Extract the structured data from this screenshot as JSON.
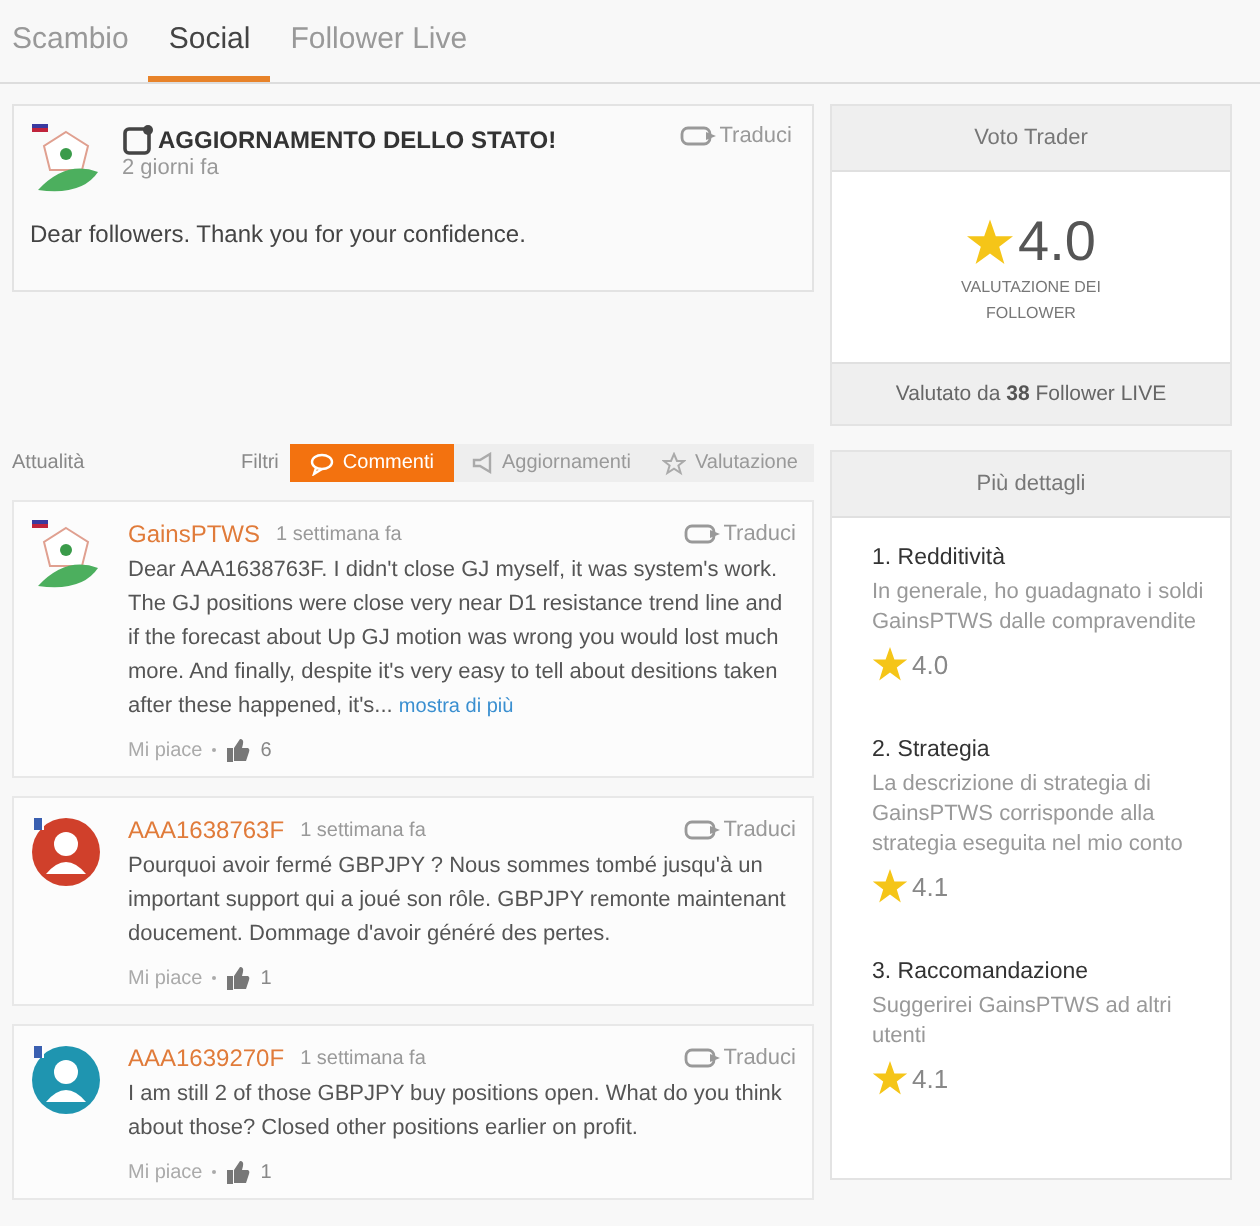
{
  "tabs": [
    {
      "label": "Scambio",
      "selected": false
    },
    {
      "label": "Social",
      "selected": true
    },
    {
      "label": "Follower Live",
      "selected": false
    }
  ],
  "status_post": {
    "avatar": {
      "kind": "logo"
    },
    "title": "AGGIORNAMENTO DELLO STATO!",
    "time": "2 giorni fa",
    "translate": "Traduci",
    "text": "Dear followers. Thank you for your confidence."
  },
  "feed": {
    "label": "Attualità",
    "filters_label": "Filtri",
    "filters": [
      {
        "label": "Commenti",
        "kind": "comment",
        "selected": true
      },
      {
        "label": "Aggiornamenti",
        "kind": "megaphone",
        "selected": false
      },
      {
        "label": "Valutazione",
        "kind": "star",
        "selected": false
      }
    ]
  },
  "comments": [
    {
      "avatar": {
        "kind": "logo"
      },
      "author": "GainsPTWS",
      "time": "1 settimana fa",
      "translate": "Traduci",
      "text": "Dear AAA1638763F. I didn't close GJ myself, it was system's work. The GJ positions were close very near D1 resistance trend line and if the forecast about Up GJ motion was wrong you would lost much more. And finally, despite it's very easy to tell about desitions taken after these happened, it's...",
      "more": "mostra di più",
      "like": "Mi piace",
      "likes": "6"
    },
    {
      "avatar": {
        "kind": "person",
        "color": "#d0402b"
      },
      "author": "AAA1638763F",
      "time": "1 settimana fa",
      "translate": "Traduci",
      "text": "Pourquoi avoir fermé GBPJPY ? Nous sommes tombé jusqu'à un important support qui a joué son rôle. GBPJPY remonte maintenant doucement. Dommage d'avoir généré des pertes.",
      "like": "Mi piace",
      "likes": "1"
    },
    {
      "avatar": {
        "kind": "person",
        "color": "#1f95b0"
      },
      "author": "AAA1639270F",
      "time": "1 settimana fa",
      "translate": "Traduci",
      "text": "I am still 2 of those GBPJPY buy positions open. What do you think about those? Closed other positions earlier on profit.",
      "like": "Mi piace",
      "likes": "1"
    }
  ],
  "trader_rating": {
    "title": "Voto Trader",
    "score": "4.0",
    "caption": "VALUTAZIONE DEI FOLLOWER",
    "footer": "Valutato da **38** Follower LIVE"
  },
  "details": {
    "title": "Più dettagli",
    "items": [
      {
        "title": "1. Redditività",
        "text": "In generale, ho guadagnato i soldi GainsPTWS dalle compravendite",
        "score": "4.0"
      },
      {
        "title": "2. Strategia",
        "text": "La descrizione di strategia di GainsPTWS corrisponde alla strategia eseguita nel mio conto",
        "score": "4.1"
      },
      {
        "title": "3. Raccomandazione",
        "text": "Suggerirei GainsPTWS ad altri utenti",
        "score": "4.1"
      }
    ]
  }
}
